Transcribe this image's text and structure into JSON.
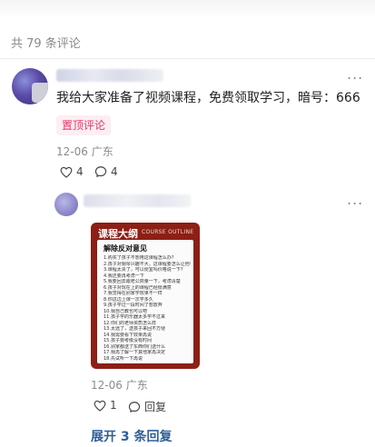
{
  "comments_header": {
    "count_label": "共 79 条评论"
  },
  "comment": {
    "text": "我给大家准备了视频课程，免费领取学习，暗号：666",
    "pinned_label": "置顶评论",
    "date": "12-06",
    "location": "广东",
    "likes": "4",
    "replies": "4",
    "more_icon": "..."
  },
  "reply": {
    "more_icon": "...",
    "poster": {
      "header": "课程大纲",
      "header_en": "COURSE OUTLINE",
      "title": "解除反对意见",
      "lines": [
        "1.购买了孩子不想用这课程怎么办?",
        "2.孩子对钢琴兴趣不大，这课程要怎么让他有兴趣学?",
        "3.课程太贵了，可以便宜吗价格说一下?",
        "4.我还要再考虑一下",
        "5.我要回去跟老公商量一下，考虑清楚",
        "6.孩子对现在上的课程已经很满意",
        "7.我觉得在别家学效果不一样",
        "8.你这边上课一次学多久",
        "9.孩子学过一段时间了想放弃",
        "10.我自己教也可以吧",
        "11.孩子学的乐器太多学不过来",
        "12.你们的老师资质怎么样",
        "13.太远了，送孩子来回不方便",
        "14.我需要看下效果再说",
        "15.孩子要考级没有时间",
        "16.别家都送了东西你们送什么",
        "17.我再了解一下其他家再决定",
        "18.先试听一下再说"
      ]
    },
    "date": "12-06",
    "location": "广东",
    "likes": "1",
    "reply_label": "回复"
  },
  "expand_label": "展开 3 条回复",
  "colors": {
    "accent_link": "#2f5f98",
    "pin_text": "#e2356a",
    "pin_bg": "#fdeef2",
    "poster_bg": "#8c1f16"
  },
  "icons": {
    "like": "heart-outline-icon",
    "reply": "speech-bubble-icon",
    "more": "ellipsis-icon"
  }
}
